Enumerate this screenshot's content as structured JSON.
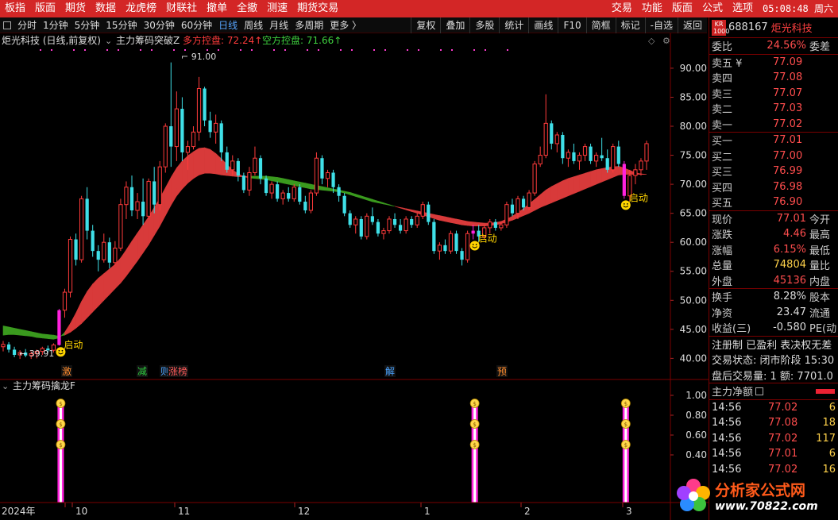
{
  "menu": {
    "left": [
      "板指",
      "版面",
      "期货",
      "数据",
      "龙虎榜",
      "财联社",
      "撤单",
      "全撤",
      "测速",
      "期货交易"
    ],
    "right": [
      "交易",
      "功能",
      "版面",
      "公式",
      "选项"
    ],
    "clock": "05:08:48 周六"
  },
  "toolbar": {
    "periods": [
      "分时",
      "1分钟",
      "5分钟",
      "15分钟",
      "30分钟",
      "60分钟",
      "日线",
      "周线",
      "月线",
      "多周期",
      "更多 〉"
    ],
    "active": "日线",
    "tools": [
      "复权",
      "叠加",
      "多股",
      "统计",
      "画线",
      "F10",
      "简框",
      "标记",
      "-自选",
      "返回"
    ]
  },
  "chart_title": {
    "stock": "炬光科技 (日线,前复权)",
    "indicator": "主力筹码突破Z",
    "bull_label": "多方控盘: 72.24↑",
    "bear_label": "空方控盘: 71.66↑",
    "high_label": "91.00",
    "low_label": "39.91"
  },
  "price_axis": [
    "90.00",
    "85.00",
    "80.00",
    "75.00",
    "70.00",
    "65.00",
    "60.00",
    "55.00",
    "50.00",
    "45.00",
    "40.00"
  ],
  "signals": [
    {
      "text": "启动",
      "pos": "start"
    },
    {
      "text": "启动",
      "pos": "mid"
    },
    {
      "text": "启动",
      "pos": "end"
    }
  ],
  "event_tags": [
    {
      "text": "激",
      "color": "#ff8c2e"
    },
    {
      "text": "减",
      "color": "#2ecc40"
    },
    {
      "text": "则",
      "color": "#4aa3ff"
    },
    {
      "text": "涨榜",
      "color": "#ff5a5a"
    },
    {
      "text": "解",
      "color": "#4aa3ff"
    },
    {
      "text": "预",
      "color": "#ff8c2e"
    }
  ],
  "sub_indicator": {
    "title": "主力筹码擒龙F",
    "axis": [
      "1.00",
      "0.80",
      "0.60",
      "0.40"
    ]
  },
  "time_axis": [
    "2024年",
    "10",
    "11",
    "12",
    "1",
    "2",
    "3"
  ],
  "quote": {
    "badge": "KR 1000",
    "code": "688167",
    "name": "炬光科技",
    "weibi_label": "委比",
    "weibi_value": "24.56%",
    "weicha_label": "委差",
    "asks": [
      {
        "label": "卖五 ¥",
        "price": "77.09"
      },
      {
        "label": "卖四",
        "price": "77.08"
      },
      {
        "label": "卖三",
        "price": "77.07"
      },
      {
        "label": "卖二",
        "price": "77.03"
      },
      {
        "label": "卖一",
        "price": "77.02"
      }
    ],
    "bids": [
      {
        "label": "买一",
        "price": "77.01"
      },
      {
        "label": "买二",
        "price": "77.00"
      },
      {
        "label": "买三",
        "price": "76.99"
      },
      {
        "label": "买四",
        "price": "76.98"
      },
      {
        "label": "买五",
        "price": "76.90"
      }
    ],
    "stats": [
      {
        "k": "现价",
        "v": "77.01",
        "k2": "今开",
        "cls": ""
      },
      {
        "k": "涨跌",
        "v": "4.46",
        "k2": "最高",
        "cls": ""
      },
      {
        "k": "涨幅",
        "v": "6.15%",
        "k2": "最低",
        "cls": ""
      },
      {
        "k": "总量",
        "v": "74804",
        "k2": "量比",
        "cls": "y"
      },
      {
        "k": "外盘",
        "v": "45136",
        "k2": "内盘",
        "cls": ""
      }
    ],
    "fin": [
      {
        "k": "换手",
        "v": "8.28%",
        "k2": "股本"
      },
      {
        "k": "净资",
        "v": "23.47",
        "k2": "流通"
      },
      {
        "k": "收益(三)",
        "v": "-0.580",
        "k2": "PE(动"
      }
    ],
    "info": [
      "注册制 已盈利 表决权无差",
      "交易状态: 闭市阶段 15:30",
      "盘后交易量: 1  额: 7701.0"
    ],
    "netflow_label": "主力净额",
    "ticks": [
      {
        "t": "14:56",
        "p": "77.02",
        "q": "6"
      },
      {
        "t": "14:56",
        "p": "77.08",
        "q": "18"
      },
      {
        "t": "14:56",
        "p": "77.02",
        "q": "117"
      },
      {
        "t": "14:56",
        "p": "77.01",
        "q": "6"
      },
      {
        "t": "14:56",
        "p": "77.02",
        "q": "16"
      }
    ]
  },
  "watermark": {
    "line1": "分析家公式网",
    "line2": "www.70822.com"
  },
  "chart_data": {
    "type": "candlestick",
    "ylim": [
      38,
      93
    ],
    "ohlc": [
      [
        42.0,
        43.0,
        41.2,
        42.4
      ],
      [
        42.4,
        42.8,
        41.0,
        41.5
      ],
      [
        41.5,
        42.0,
        40.2,
        40.6
      ],
      [
        40.6,
        41.4,
        39.9,
        41.0
      ],
      [
        41.0,
        41.6,
        40.2,
        40.5
      ],
      [
        40.5,
        41.2,
        39.9,
        40.8
      ],
      [
        40.8,
        41.5,
        40.0,
        41.2
      ],
      [
        41.2,
        42.0,
        40.6,
        41.7
      ],
      [
        41.7,
        42.2,
        41.0,
        41.4
      ],
      [
        41.4,
        42.6,
        41.0,
        42.3
      ],
      [
        42.3,
        48.5,
        42.2,
        48.3
      ],
      [
        48.3,
        52.0,
        47.0,
        51.4
      ],
      [
        51.4,
        61.0,
        50.5,
        60.5
      ],
      [
        60.5,
        61.5,
        56.0,
        57.0
      ],
      [
        57.0,
        68.0,
        56.5,
        67.5
      ],
      [
        67.5,
        69.5,
        60.5,
        62.0
      ],
      [
        62.0,
        63.0,
        57.5,
        58.5
      ],
      [
        58.5,
        59.5,
        55.0,
        57.0
      ],
      [
        57.0,
        61.5,
        56.5,
        60.0
      ],
      [
        60.0,
        60.8,
        55.5,
        56.5
      ],
      [
        56.5,
        60.2,
        56.0,
        59.0
      ],
      [
        59.0,
        67.5,
        58.5,
        66.5
      ],
      [
        66.5,
        70.5,
        64.0,
        69.5
      ],
      [
        69.5,
        71.5,
        64.5,
        65.5
      ],
      [
        65.5,
        68.5,
        64.0,
        67.0
      ],
      [
        67.0,
        71.0,
        63.0,
        64.5
      ],
      [
        64.5,
        71.0,
        64.0,
        70.5
      ],
      [
        70.5,
        73.0,
        65.0,
        66.5
      ],
      [
        66.5,
        74.0,
        65.5,
        73.0
      ],
      [
        73.0,
        80.5,
        72.0,
        80.0
      ],
      [
        80.0,
        91.0,
        73.0,
        76.5
      ],
      [
        76.5,
        86.0,
        74.0,
        83.0
      ],
      [
        83.0,
        85.0,
        74.0,
        75.5
      ],
      [
        75.5,
        77.5,
        72.5,
        76.5
      ],
      [
        76.5,
        80.0,
        76.0,
        79.0
      ],
      [
        79.0,
        88.5,
        77.5,
        86.5
      ],
      [
        86.5,
        86.8,
        80.0,
        81.0
      ],
      [
        81.0,
        82.5,
        78.0,
        79.0
      ],
      [
        79.0,
        82.0,
        77.0,
        80.5
      ],
      [
        80.5,
        81.0,
        74.0,
        75.5
      ],
      [
        75.5,
        76.5,
        72.0,
        72.5
      ],
      [
        72.5,
        75.0,
        71.5,
        74.0
      ],
      [
        74.0,
        74.5,
        70.5,
        71.5
      ],
      [
        71.5,
        72.0,
        68.5,
        69.0
      ],
      [
        69.0,
        73.0,
        68.0,
        72.0
      ],
      [
        72.0,
        76.5,
        71.5,
        74.5
      ],
      [
        74.5,
        75.0,
        70.0,
        71.0
      ],
      [
        71.0,
        71.5,
        68.0,
        68.5
      ],
      [
        68.5,
        70.5,
        67.5,
        70.0
      ],
      [
        70.0,
        70.5,
        67.0,
        67.5
      ],
      [
        67.5,
        69.0,
        66.5,
        68.5
      ],
      [
        68.5,
        69.5,
        67.0,
        67.5
      ],
      [
        67.5,
        70.0,
        67.0,
        69.5
      ],
      [
        69.5,
        70.0,
        66.5,
        67.0
      ],
      [
        67.0,
        68.0,
        65.0,
        65.5
      ],
      [
        65.5,
        69.0,
        65.0,
        68.5
      ],
      [
        68.5,
        75.5,
        68.0,
        74.5
      ],
      [
        74.5,
        75.0,
        70.0,
        71.0
      ],
      [
        71.0,
        72.5,
        69.5,
        72.0
      ],
      [
        72.0,
        72.5,
        68.5,
        69.5
      ],
      [
        69.5,
        70.0,
        67.0,
        68.0
      ],
      [
        68.0,
        68.5,
        64.5,
        65.0
      ],
      [
        65.0,
        65.5,
        62.5,
        63.0
      ],
      [
        63.0,
        64.5,
        61.5,
        64.0
      ],
      [
        64.0,
        64.5,
        60.5,
        61.0
      ],
      [
        61.0,
        65.0,
        60.5,
        64.5
      ],
      [
        64.5,
        66.0,
        63.0,
        63.5
      ],
      [
        63.5,
        64.0,
        61.0,
        61.5
      ],
      [
        61.5,
        62.5,
        60.5,
        62.0
      ],
      [
        62.0,
        64.5,
        61.5,
        64.0
      ],
      [
        64.0,
        65.0,
        62.5,
        63.0
      ],
      [
        63.0,
        64.0,
        61.5,
        62.0
      ],
      [
        62.0,
        64.5,
        61.5,
        64.0
      ],
      [
        64.0,
        64.5,
        62.5,
        63.0
      ],
      [
        63.0,
        65.0,
        62.5,
        64.5
      ],
      [
        64.5,
        67.0,
        64.0,
        66.5
      ],
      [
        66.5,
        67.0,
        63.0,
        63.5
      ],
      [
        63.5,
        64.0,
        58.0,
        58.5
      ],
      [
        58.5,
        60.0,
        57.0,
        59.5
      ],
      [
        59.5,
        60.5,
        58.0,
        58.5
      ],
      [
        58.5,
        62.0,
        58.0,
        61.5
      ],
      [
        61.5,
        62.0,
        58.0,
        58.5
      ],
      [
        58.5,
        59.0,
        56.0,
        57.0
      ],
      [
        57.0,
        62.0,
        56.5,
        61.5
      ],
      [
        61.5,
        63.0,
        60.5,
        62.0
      ],
      [
        62.0,
        63.0,
        60.0,
        61.0
      ],
      [
        61.0,
        63.0,
        60.5,
        62.5
      ],
      [
        62.5,
        64.0,
        61.5,
        63.5
      ],
      [
        63.5,
        64.0,
        62.0,
        62.5
      ],
      [
        62.5,
        63.5,
        62.0,
        63.0
      ],
      [
        63.0,
        67.0,
        62.5,
        66.5
      ],
      [
        66.5,
        67.5,
        64.5,
        65.0
      ],
      [
        65.0,
        68.0,
        64.0,
        67.5
      ],
      [
        67.5,
        68.0,
        65.5,
        66.0
      ],
      [
        66.0,
        69.0,
        65.5,
        68.5
      ],
      [
        68.5,
        74.0,
        68.0,
        73.5
      ],
      [
        73.5,
        76.5,
        73.0,
        75.0
      ],
      [
        75.0,
        85.5,
        74.5,
        80.5
      ],
      [
        80.5,
        81.0,
        76.0,
        77.0
      ],
      [
        77.0,
        79.0,
        75.5,
        78.5
      ],
      [
        78.5,
        79.0,
        73.5,
        74.5
      ],
      [
        74.5,
        76.0,
        73.0,
        75.5
      ],
      [
        75.5,
        77.0,
        73.5,
        74.0
      ],
      [
        74.0,
        75.5,
        72.5,
        75.0
      ],
      [
        75.0,
        77.0,
        74.0,
        76.5
      ],
      [
        76.5,
        77.0,
        73.5,
        74.0
      ],
      [
        74.0,
        75.5,
        73.0,
        75.0
      ],
      [
        75.0,
        78.0,
        74.0,
        74.5
      ],
      [
        74.5,
        76.0,
        72.0,
        72.5
      ],
      [
        72.5,
        77.0,
        72.0,
        76.5
      ],
      [
        76.5,
        77.5,
        73.0,
        73.5
      ],
      [
        73.5,
        74.0,
        67.5,
        68.0
      ],
      [
        68.0,
        72.5,
        67.0,
        71.5
      ],
      [
        71.5,
        73.5,
        70.0,
        72.5
      ],
      [
        72.5,
        74.5,
        71.5,
        74.0
      ],
      [
        74.0,
        77.5,
        72.5,
        77.0
      ]
    ],
    "upper_band": [
      44.0,
      44.1,
      44.1,
      44.0,
      43.9,
      43.8,
      43.6,
      43.5,
      43.4,
      43.3,
      43.5,
      44.5,
      46.0,
      47.8,
      49.8,
      51.5,
      52.8,
      53.8,
      54.6,
      55.4,
      56.2,
      57.3,
      58.7,
      60.2,
      61.6,
      63.0,
      64.4,
      66.0,
      67.6,
      69.4,
      71.2,
      72.8,
      74.0,
      74.9,
      75.6,
      76.2,
      76.3,
      76.0,
      75.3,
      74.4,
      73.4,
      72.5,
      71.8,
      71.3,
      71.1,
      71.0,
      70.9,
      70.8,
      70.6,
      70.4,
      70.2,
      70.0,
      69.8,
      69.6,
      69.4,
      69.2,
      69.1,
      69.0,
      68.9,
      68.8,
      68.7,
      68.5,
      68.2,
      67.9,
      67.6,
      67.3,
      67.0,
      66.8,
      66.6,
      66.4,
      66.2,
      66.0,
      65.8,
      65.6,
      65.4,
      65.2,
      65.0,
      64.8,
      64.6,
      64.4,
      64.2,
      64.0,
      63.8,
      63.6,
      63.5,
      63.4,
      63.3,
      63.3,
      63.4,
      63.6,
      64.0,
      64.5,
      65.1,
      65.8,
      66.6,
      67.4,
      68.2,
      69.0,
      69.6,
      70.1,
      70.6,
      71.0,
      71.3,
      71.6,
      71.9,
      72.2,
      72.5,
      72.7,
      72.9,
      73.0,
      73.1,
      72.8,
      72.4,
      72.0,
      71.8,
      71.7
    ],
    "lower_band": [
      45.6,
      45.4,
      45.2,
      45.0,
      44.8,
      44.6,
      44.4,
      44.2,
      44.1,
      44.0,
      43.8,
      44.0,
      44.5,
      45.2,
      46.0,
      47.0,
      48.0,
      49.0,
      50.0,
      51.0,
      52.0,
      53.0,
      54.2,
      55.5,
      56.8,
      58.2,
      59.6,
      61.2,
      62.8,
      64.6,
      66.4,
      68.0,
      69.2,
      70.2,
      71.0,
      71.6,
      71.9,
      71.9,
      71.8,
      71.6,
      71.5,
      71.4,
      71.3,
      71.3,
      71.4,
      71.4,
      71.4,
      71.4,
      71.3,
      71.2,
      71.0,
      70.8,
      70.6,
      70.4,
      70.2,
      70.0,
      69.8,
      69.6,
      69.4,
      69.2,
      69.0,
      68.8,
      68.6,
      68.3,
      68.0,
      67.7,
      67.4,
      67.1,
      66.8,
      66.5,
      66.2,
      65.9,
      65.6,
      65.3,
      65.0,
      64.7,
      64.4,
      64.1,
      63.8,
      63.6,
      63.4,
      63.2,
      63.0,
      62.9,
      62.8,
      62.8,
      62.8,
      62.9,
      63.0,
      63.2,
      63.5,
      63.8,
      64.2,
      64.6,
      65.0,
      65.5,
      66.0,
      66.4,
      66.8,
      67.2,
      67.6,
      68.0,
      68.4,
      68.8,
      69.2,
      69.6,
      70.0,
      70.4,
      70.8,
      71.2,
      71.6,
      71.7,
      71.7,
      71.7,
      71.7,
      71.7
    ],
    "signal_bars": [
      10,
      84,
      111
    ]
  }
}
